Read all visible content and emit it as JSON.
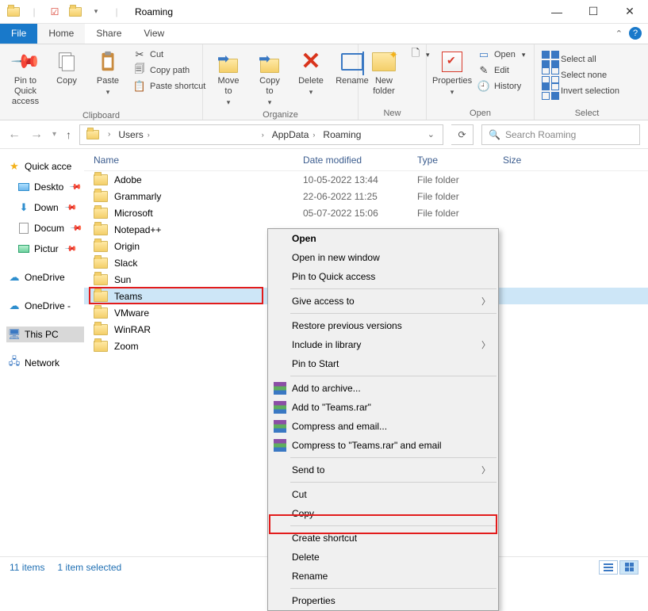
{
  "window": {
    "title": "Roaming"
  },
  "tabs": {
    "file": "File",
    "home": "Home",
    "share": "Share",
    "view": "View"
  },
  "ribbon": {
    "clipboard": {
      "label": "Clipboard",
      "pin": "Pin to Quick\naccess",
      "copy": "Copy",
      "paste": "Paste",
      "cut": "Cut",
      "copypath": "Copy path",
      "pastesc": "Paste shortcut"
    },
    "organize": {
      "label": "Organize",
      "moveto": "Move\nto",
      "copyto": "Copy\nto",
      "delete": "Delete",
      "rename": "Rename"
    },
    "new_": {
      "label": "New",
      "newfolder": "New\nfolder"
    },
    "open": {
      "label": "Open",
      "properties": "Properties",
      "open": "Open",
      "edit": "Edit",
      "history": "History"
    },
    "select": {
      "label": "Select",
      "all": "Select all",
      "none": "Select none",
      "invert": "Invert selection"
    }
  },
  "breadcrumbs": {
    "c1": "Users",
    "c2": "AppData",
    "c3": "Roaming"
  },
  "search": {
    "placeholder": "Search Roaming"
  },
  "columns": {
    "name": "Name",
    "date": "Date modified",
    "type": "Type",
    "size": "Size"
  },
  "rows": [
    {
      "name": "Adobe",
      "date": "10-05-2022 13:44",
      "type": "File folder"
    },
    {
      "name": "Grammarly",
      "date": "22-06-2022 11:25",
      "type": "File folder"
    },
    {
      "name": "Microsoft",
      "date": "05-07-2022 15:06",
      "type": "File folder"
    },
    {
      "name": "Notepad++",
      "date": "",
      "type": ""
    },
    {
      "name": "Origin",
      "date": "",
      "type": ""
    },
    {
      "name": "Slack",
      "date": "",
      "type": ""
    },
    {
      "name": "Sun",
      "date": "",
      "type": ""
    },
    {
      "name": "Teams",
      "date": "",
      "type": ""
    },
    {
      "name": "VMware",
      "date": "",
      "type": ""
    },
    {
      "name": "WinRAR",
      "date": "",
      "type": ""
    },
    {
      "name": "Zoom",
      "date": "",
      "type": ""
    }
  ],
  "sidebar": {
    "quick": "Quick acce",
    "desktop": "Deskto",
    "down": "Down",
    "docs": "Docum",
    "pics": "Pictur",
    "od1": "OneDrive",
    "od2": "OneDrive -",
    "thispc": "This PC",
    "network": "Network"
  },
  "ctx": {
    "open": "Open",
    "newwin": "Open in new window",
    "pinq": "Pin to Quick access",
    "give": "Give access to",
    "restore": "Restore previous versions",
    "lib": "Include in library",
    "pinstart": "Pin to Start",
    "addarc": "Add to archive...",
    "addrar": "Add to \"Teams.rar\"",
    "compem": "Compress and email...",
    "comprar": "Compress to \"Teams.rar\" and email",
    "sendto": "Send to",
    "cut": "Cut",
    "copy": "Copy",
    "shortcut": "Create shortcut",
    "delete": "Delete",
    "rename": "Rename",
    "props": "Properties"
  },
  "status": {
    "items": "11 items",
    "sel": "1 item selected"
  }
}
